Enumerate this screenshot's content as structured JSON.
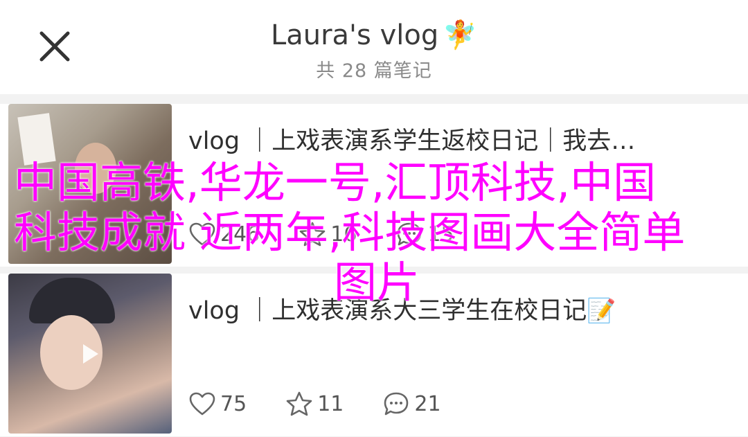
{
  "header": {
    "title": "Laura's vlog",
    "title_emoji": "🧚",
    "subtitle": "共 28 篇笔记"
  },
  "notes": [
    {
      "title": "vlog ｜上戏表演系学生返校日记｜我去…",
      "has_video": false,
      "likes": "246",
      "stars": "16",
      "comments": "15"
    },
    {
      "title": "vlog ｜上戏表演系大三学生在校日记",
      "title_emoji": "📝",
      "has_video": true,
      "likes": "75",
      "stars": "11",
      "comments": "21"
    }
  ],
  "overlay": {
    "line1": "中国高铁,华龙一号,汇顶科技,中国",
    "line2": "科技成就 近两年,科技图画大全简单",
    "line3": "图片",
    "color": "#ff00ff"
  },
  "icons": {
    "close": "close-icon",
    "like": "heart-icon",
    "star": "star-icon",
    "comment": "comment-icon",
    "play": "play-icon"
  }
}
